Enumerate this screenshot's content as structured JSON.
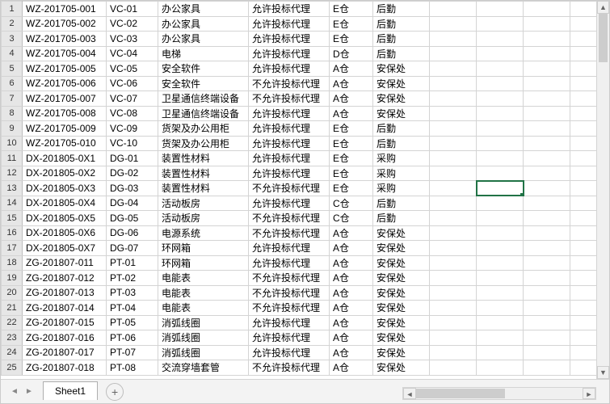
{
  "sheet": {
    "name": "Sheet1"
  },
  "selected": {
    "row": 13,
    "col": "H"
  },
  "rows": [
    {
      "n": 1,
      "A": "WZ-201705-001",
      "B": "VC-01",
      "C": "办公家具",
      "D": "允许投标代理",
      "E": "E仓",
      "F": "后勤"
    },
    {
      "n": 2,
      "A": "WZ-201705-002",
      "B": "VC-02",
      "C": "办公家具",
      "D": "允许投标代理",
      "E": "E仓",
      "F": "后勤"
    },
    {
      "n": 3,
      "A": "WZ-201705-003",
      "B": "VC-03",
      "C": "办公家具",
      "D": "允许投标代理",
      "E": "E仓",
      "F": "后勤"
    },
    {
      "n": 4,
      "A": "WZ-201705-004",
      "B": "VC-04",
      "C": "电梯",
      "D": "允许投标代理",
      "E": "D仓",
      "F": "后勤"
    },
    {
      "n": 5,
      "A": "WZ-201705-005",
      "B": "VC-05",
      "C": "安全软件",
      "D": "允许投标代理",
      "E": "A仓",
      "F": "安保处"
    },
    {
      "n": 6,
      "A": "WZ-201705-006",
      "B": "VC-06",
      "C": "安全软件",
      "D": "不允许投标代理",
      "E": "A仓",
      "F": "安保处"
    },
    {
      "n": 7,
      "A": "WZ-201705-007",
      "B": "VC-07",
      "C": "卫星通信终端设备",
      "D": "不允许投标代理",
      "E": "A仓",
      "F": "安保处"
    },
    {
      "n": 8,
      "A": "WZ-201705-008",
      "B": "VC-08",
      "C": "卫星通信终端设备",
      "D": "允许投标代理",
      "E": "A仓",
      "F": "安保处"
    },
    {
      "n": 9,
      "A": "WZ-201705-009",
      "B": "VC-09",
      "C": "货架及办公用柜",
      "D": "允许投标代理",
      "E": "E仓",
      "F": "后勤"
    },
    {
      "n": 10,
      "A": "WZ-201705-010",
      "B": "VC-10",
      "C": "货架及办公用柜",
      "D": "允许投标代理",
      "E": "E仓",
      "F": "后勤"
    },
    {
      "n": 11,
      "A": "DX-201805-0X1",
      "B": "DG-01",
      "C": "装置性材料",
      "D": "允许投标代理",
      "E": "E仓",
      "F": "采购"
    },
    {
      "n": 12,
      "A": "DX-201805-0X2",
      "B": "DG-02",
      "C": "装置性材料",
      "D": "允许投标代理",
      "E": "E仓",
      "F": "采购"
    },
    {
      "n": 13,
      "A": "DX-201805-0X3",
      "B": "DG-03",
      "C": "装置性材料",
      "D": "不允许投标代理",
      "E": "E仓",
      "F": "采购"
    },
    {
      "n": 14,
      "A": "DX-201805-0X4",
      "B": "DG-04",
      "C": "活动板房",
      "D": "允许投标代理",
      "E": "C仓",
      "F": "后勤"
    },
    {
      "n": 15,
      "A": "DX-201805-0X5",
      "B": "DG-05",
      "C": "活动板房",
      "D": "不允许投标代理",
      "E": "C仓",
      "F": "后勤"
    },
    {
      "n": 16,
      "A": "DX-201805-0X6",
      "B": "DG-06",
      "C": "电源系统",
      "D": "不允许投标代理",
      "E": "A仓",
      "F": "安保处"
    },
    {
      "n": 17,
      "A": "DX-201805-0X7",
      "B": "DG-07",
      "C": "环网箱",
      "D": "允许投标代理",
      "E": "A仓",
      "F": "安保处"
    },
    {
      "n": 18,
      "A": "ZG-201807-011",
      "B": "PT-01",
      "C": "环网箱",
      "D": "允许投标代理",
      "E": "A仓",
      "F": "安保处"
    },
    {
      "n": 19,
      "A": "ZG-201807-012",
      "B": "PT-02",
      "C": "电能表",
      "D": "不允许投标代理",
      "E": "A仓",
      "F": "安保处"
    },
    {
      "n": 20,
      "A": "ZG-201807-013",
      "B": "PT-03",
      "C": "电能表",
      "D": "不允许投标代理",
      "E": "A仓",
      "F": "安保处"
    },
    {
      "n": 21,
      "A": "ZG-201807-014",
      "B": "PT-04",
      "C": "电能表",
      "D": "不允许投标代理",
      "E": "A仓",
      "F": "安保处"
    },
    {
      "n": 22,
      "A": "ZG-201807-015",
      "B": "PT-05",
      "C": "消弧线圈",
      "D": "允许投标代理",
      "E": "A仓",
      "F": "安保处"
    },
    {
      "n": 23,
      "A": "ZG-201807-016",
      "B": "PT-06",
      "C": "消弧线圈",
      "D": "允许投标代理",
      "E": "A仓",
      "F": "安保处"
    },
    {
      "n": 24,
      "A": "ZG-201807-017",
      "B": "PT-07",
      "C": "消弧线圈",
      "D": "允许投标代理",
      "E": "A仓",
      "F": "安保处"
    },
    {
      "n": 25,
      "A": "ZG-201807-018",
      "B": "PT-08",
      "C": "交流穿墙套管",
      "D": "不允许投标代理",
      "E": "A仓",
      "F": "安保处"
    }
  ]
}
